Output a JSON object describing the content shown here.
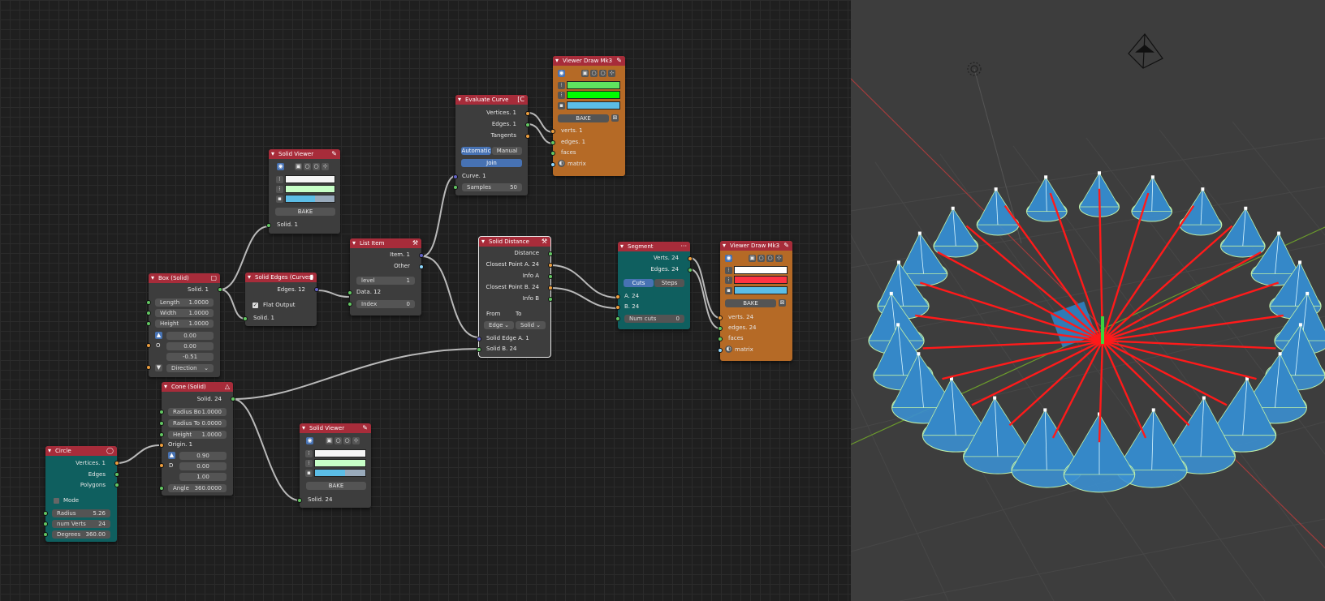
{
  "nodes": {
    "circle": {
      "title": "Circle",
      "outputs": [
        "Vertices. 1",
        "Edges",
        "Polygons"
      ],
      "mode_label": "Mode",
      "fields": [
        {
          "label": "Radius",
          "value": "5.26"
        },
        {
          "label": "num Verts",
          "value": "24"
        },
        {
          "label": "Degrees",
          "value": "360.00"
        }
      ]
    },
    "box": {
      "title": "Box (Solid)",
      "output": "Solid. 1",
      "fields": [
        {
          "label": "Length",
          "value": "1.0000"
        },
        {
          "label": "Width",
          "value": "1.0000"
        },
        {
          "label": "Height",
          "value": "1.0000"
        }
      ],
      "origin_label": "O",
      "vec": [
        "0.00",
        "0.00",
        "-0.51"
      ],
      "direction": "Direction"
    },
    "cone": {
      "title": "Cone (Solid)",
      "output": "Solid. 24",
      "fields": [
        {
          "label": "Radius Bo",
          "value": "1.0000"
        },
        {
          "label": "Radius To",
          "value": "0.0000"
        },
        {
          "label": "Height",
          "value": "1.0000"
        }
      ],
      "origin": "Origin. 1",
      "d_label": "D",
      "vec": [
        "0.90",
        "0.00",
        "1.00"
      ],
      "angle_label": "Angle",
      "angle": "360.0000"
    },
    "solid_viewer_top": {
      "title": "Solid Viewer",
      "bake": "BAKE",
      "input": "Solid. 1"
    },
    "solid_viewer_bottom": {
      "title": "Solid Viewer",
      "bake": "BAKE",
      "input": "Solid. 24"
    },
    "solid_edges": {
      "title": "Solid Edges (Curves)",
      "output": "Edges. 12",
      "checkbox": "Flat Output",
      "input": "Solid. 1"
    },
    "list_item": {
      "title": "List Item",
      "outputs": [
        "Item. 1",
        "Other"
      ],
      "level_label": "level",
      "level": "1",
      "input": "Data. 12",
      "index_label": "Index",
      "index": "0"
    },
    "evaluate_curve": {
      "title": "Evaluate Curve",
      "outputs": [
        "Vertices. 1",
        "Edges. 1",
        "Tangents"
      ],
      "modes": [
        "Automatic",
        "Manual"
      ],
      "join": "Join",
      "input": "Curve. 1",
      "samples_label": "Samples",
      "samples": "50"
    },
    "viewer_top": {
      "title": "Viewer Draw Mk3",
      "bake": "BAKE",
      "inputs": [
        "verts. 1",
        "edges. 1",
        "faces",
        "matrix"
      ]
    },
    "viewer_right": {
      "title": "Viewer Draw Mk3",
      "bake": "BAKE",
      "inputs": [
        "verts. 24",
        "edges. 24",
        "faces",
        "matrix"
      ]
    },
    "solid_distance": {
      "title": "Solid Distance",
      "outputs": [
        "Distance",
        "Closest Point A. 24",
        "Info A",
        "Closest Point B. 24",
        "Info B"
      ],
      "from_label": "From",
      "to_label": "To",
      "from": "Edge",
      "to": "Solid",
      "inputs": [
        "Solid Edge A. 1",
        "Solid B. 24"
      ]
    },
    "segment": {
      "title": "Segment",
      "outputs": [
        "Verts. 24",
        "Edges. 24"
      ],
      "modes": [
        "Cuts",
        "Steps"
      ],
      "inputs": [
        "A. 24",
        "B. 24"
      ],
      "numcuts_label": "Num cuts",
      "numcuts": "0"
    }
  },
  "colors": {
    "header_red": "#a72c3a",
    "teal": "#0f5f5f",
    "orange": "#b56a26",
    "socket_green": "#63c763",
    "socket_orange": "#ed9e3e",
    "socket_blue": "#6363c7",
    "line_red": "#ff1a1a",
    "cone_blue": "#3b8fd0"
  }
}
